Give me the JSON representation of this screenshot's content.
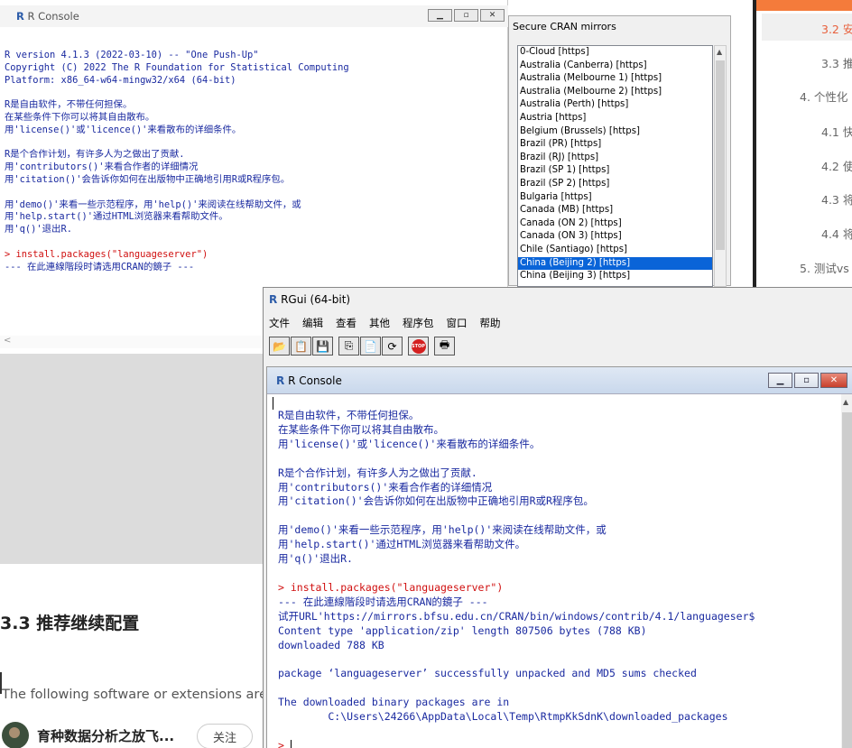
{
  "background_console": {
    "title": "R Console",
    "lines": [
      {
        "text": "R version 4.1.3 (2022-03-10) -- \"One Push-Up\"",
        "color": "blue"
      },
      {
        "text": "Copyright (C) 2022 The R Foundation for Statistical Computing",
        "color": "blue"
      },
      {
        "text": "Platform: x86_64-w64-mingw32/x64 (64-bit)",
        "color": "blue"
      },
      {
        "text": "",
        "color": "blue"
      },
      {
        "text": "R是自由软件，不带任何担保。",
        "color": "blue"
      },
      {
        "text": "在某些条件下你可以将其自由散布。",
        "color": "blue"
      },
      {
        "text": "用'license()'或'licence()'来看散布的详细条件。",
        "color": "blue"
      },
      {
        "text": "",
        "color": "blue"
      },
      {
        "text": "R是个合作计划，有许多人为之做出了贡献.",
        "color": "blue"
      },
      {
        "text": "用'contributors()'来看合作者的详细情况",
        "color": "blue"
      },
      {
        "text": "用'citation()'会告诉你如何在出版物中正确地引用R或R程序包。",
        "color": "blue"
      },
      {
        "text": "",
        "color": "blue"
      },
      {
        "text": "用'demo()'来看一些示范程序，用'help()'来阅读在线帮助文件，或",
        "color": "blue"
      },
      {
        "text": "用'help.start()'通过HTML浏览器来看帮助文件。",
        "color": "blue"
      },
      {
        "text": "用'q()'退出R.",
        "color": "blue"
      },
      {
        "text": "",
        "color": "blue"
      },
      {
        "text": "> install.packages(\"languageserver\")",
        "color": "red"
      },
      {
        "text": "--- 在此連線階段时请选用CRAN的鏡子 ---",
        "color": "blue"
      }
    ]
  },
  "mirrors_dialog": {
    "title": "Secure CRAN mirrors",
    "items": [
      "0-Cloud [https]",
      "Australia (Canberra) [https]",
      "Australia (Melbourne 1) [https]",
      "Australia (Melbourne 2) [https]",
      "Australia (Perth) [https]",
      "Austria [https]",
      "Belgium (Brussels) [https]",
      "Brazil (PR) [https]",
      "Brazil (RJ) [https]",
      "Brazil (SP 1) [https]",
      "Brazil (SP 2) [https]",
      "Bulgaria [https]",
      "Canada (MB) [https]",
      "Canada (ON 2) [https]",
      "Canada (ON 3) [https]",
      "Chile (Santiago) [https]",
      "China (Beijing 2) [https]",
      "China (Beijing 3) [https]"
    ],
    "selected": "China (Beijing 2) [https]"
  },
  "toc": {
    "items": [
      "3.2 安",
      "3.3 推",
      "4. 个性化",
      "4.1 快",
      "4.2 使",
      "4.3 将",
      "4.4 将",
      "5. 测试vs"
    ]
  },
  "article": {
    "heading": "3.3 推荐继续配置",
    "desc": "The following software or extensions are",
    "author": "育种数据分析之放飞...",
    "follow_label": "关注"
  },
  "rgui": {
    "title": "RGui (64-bit)",
    "menu": [
      "文件",
      "编辑",
      "查看",
      "其他",
      "程序包",
      "窗口",
      "帮助"
    ],
    "toolbar_icons": [
      "open-script-icon",
      "load-workspace-icon",
      "save-icon",
      "copy-icon",
      "paste-icon",
      "copy-paste-icon",
      "stop-icon",
      "print-icon"
    ],
    "stop_label": "STOP",
    "console": {
      "title": "R Console",
      "lines": [
        {
          "text": "R是自由软件，不带任何担保。",
          "color": "blue"
        },
        {
          "text": "在某些条件下你可以将其自由散布。",
          "color": "blue"
        },
        {
          "text": "用'license()'或'licence()'来看散布的详细条件。",
          "color": "blue"
        },
        {
          "text": "",
          "color": "blue"
        },
        {
          "text": "R是个合作计划，有许多人为之做出了贡献.",
          "color": "blue"
        },
        {
          "text": "用'contributors()'来看合作者的详细情况",
          "color": "blue"
        },
        {
          "text": "用'citation()'会告诉你如何在出版物中正确地引用R或R程序包。",
          "color": "blue"
        },
        {
          "text": "",
          "color": "blue"
        },
        {
          "text": "用'demo()'来看一些示范程序，用'help()'来阅读在线帮助文件，或",
          "color": "blue"
        },
        {
          "text": "用'help.start()'通过HTML浏览器来看帮助文件。",
          "color": "blue"
        },
        {
          "text": "用'q()'退出R.",
          "color": "blue"
        },
        {
          "text": "",
          "color": "blue"
        },
        {
          "text": "> install.packages(\"languageserver\")",
          "color": "red"
        },
        {
          "text": "--- 在此連線階段时请选用CRAN的鏡子 ---",
          "color": "blue"
        },
        {
          "text": "试开URL'https://mirrors.bfsu.edu.cn/CRAN/bin/windows/contrib/4.1/languageser$",
          "color": "blue"
        },
        {
          "text": "Content type 'application/zip' length 807506 bytes (788 KB)",
          "color": "blue"
        },
        {
          "text": "downloaded 788 KB",
          "color": "blue"
        },
        {
          "text": "",
          "color": "blue"
        },
        {
          "text": "package ‘languageserver’ successfully unpacked and MD5 sums checked",
          "color": "blue"
        },
        {
          "text": "",
          "color": "blue"
        },
        {
          "text": "The downloaded binary packages are in",
          "color": "blue"
        },
        {
          "text": "        C:\\Users\\24266\\AppData\\Local\\Temp\\RtmpKkSdnK\\downloaded_packages",
          "color": "blue"
        }
      ],
      "prompt": "> "
    }
  }
}
